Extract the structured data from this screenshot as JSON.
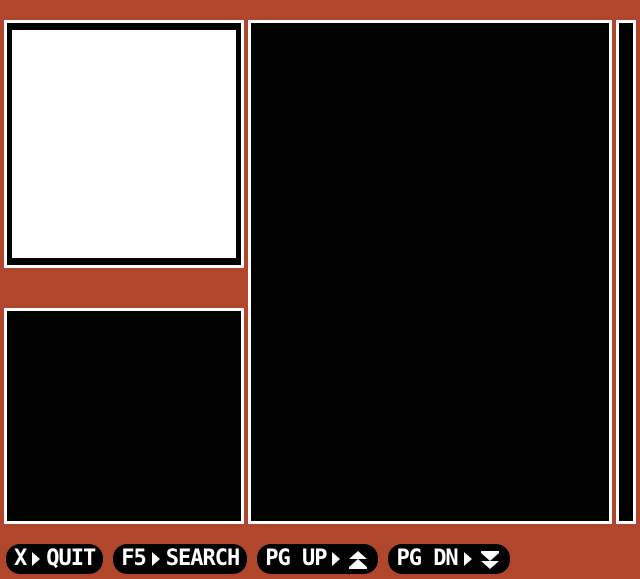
{
  "colors": {
    "background": "#b0472c",
    "panel": "#000000",
    "border": "#ffffff",
    "preview_fill": "#ffffff"
  },
  "footer": {
    "quit": {
      "key": "X",
      "label": "QUIT"
    },
    "search": {
      "key": "F5",
      "label": "SEARCH"
    },
    "page_up": {
      "key": "PG UP",
      "icon": "double-up-arrow-icon"
    },
    "page_down": {
      "key": "PG DN",
      "icon": "double-down-arrow-icon"
    }
  }
}
